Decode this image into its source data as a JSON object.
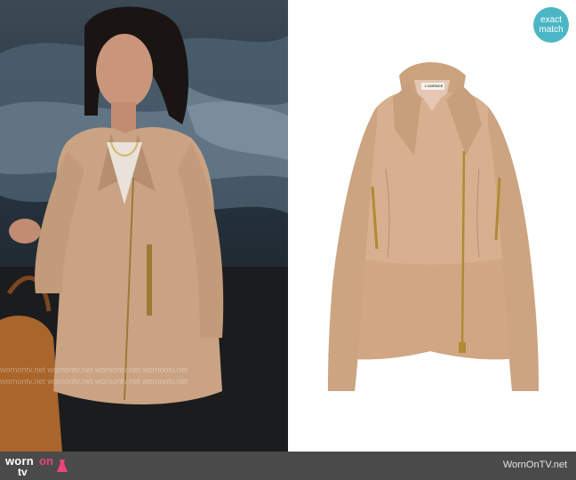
{
  "badge": {
    "line1": "exact",
    "line2": "match"
  },
  "product": {
    "brand_label": "L'AGENCE"
  },
  "watermark": {
    "text": "wornontv.net"
  },
  "footer": {
    "logo_worn": "worn",
    "logo_on": "on",
    "logo_tv": "tv",
    "site": "WornOnTV.net"
  },
  "colors": {
    "jacket": "#d7b08f",
    "zipper": "#b08a32",
    "badge": "#4cb7c4",
    "footer_bg": "#4a4a4a",
    "logo_accent": "#e8457a"
  }
}
